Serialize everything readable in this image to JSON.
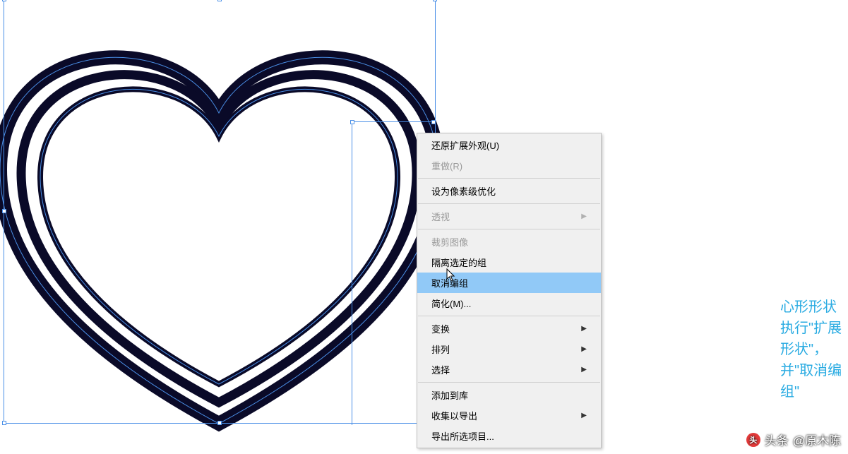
{
  "menu": {
    "undo": "还原扩展外观(U)",
    "redo": "重做(R)",
    "pixel_optimize": "设为像素级优化",
    "perspective": "透视",
    "crop_image": "裁剪图像",
    "isolate_group": "隔离选定的组",
    "ungroup": "取消编组",
    "simplify": "简化(M)...",
    "transform": "变换",
    "arrange": "排列",
    "select": "选择",
    "add_to_library": "添加到库",
    "collect_export": "收集以导出",
    "export_selection": "导出所选项目..."
  },
  "side_note": "心形形状执行\"扩展形状\"，并\"取消编组\"",
  "watermark": {
    "prefix": "头条",
    "author": "@原木陈"
  }
}
